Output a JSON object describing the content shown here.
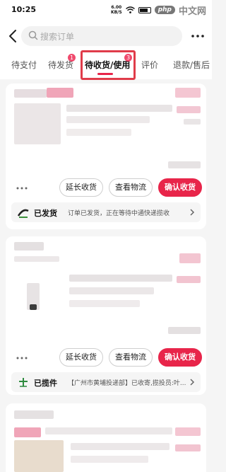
{
  "status_bar": {
    "time": "10:25",
    "speed_value": "6.00",
    "speed_unit": "KB/S",
    "watermark_logo": "php",
    "watermark_site": "中文网"
  },
  "header": {
    "search_placeholder": "搜索订单",
    "back_icon": "chevron-left-icon",
    "search_icon": "search-icon",
    "more_icon": "ellipsis-icon"
  },
  "tabs": [
    {
      "label": "待支付"
    },
    {
      "label": "待发货",
      "badge": "1"
    },
    {
      "label": "待收货/使用",
      "badge": "3",
      "active": true
    },
    {
      "label": "评价"
    },
    {
      "label": "退款/售后"
    }
  ],
  "orders": [
    {
      "buttons": {
        "extend": "延长收货",
        "logistics": "查看物流",
        "confirm": "确认收货"
      },
      "shipping": {
        "status": "已发货",
        "text": "订单已发货，正在等待中通快递揽收"
      }
    },
    {
      "buttons": {
        "extend": "延长收货",
        "logistics": "查看物流",
        "confirm": "确认收货"
      },
      "shipping": {
        "status": "已揽件",
        "text": "【广州市黄埔投递部】已收寄,揽投员:叶..."
      }
    }
  ],
  "colors": {
    "accent": "#e8254a",
    "badge": "#f04a6d",
    "highlight": "#e03c4a",
    "background": "#f5f5f5"
  }
}
